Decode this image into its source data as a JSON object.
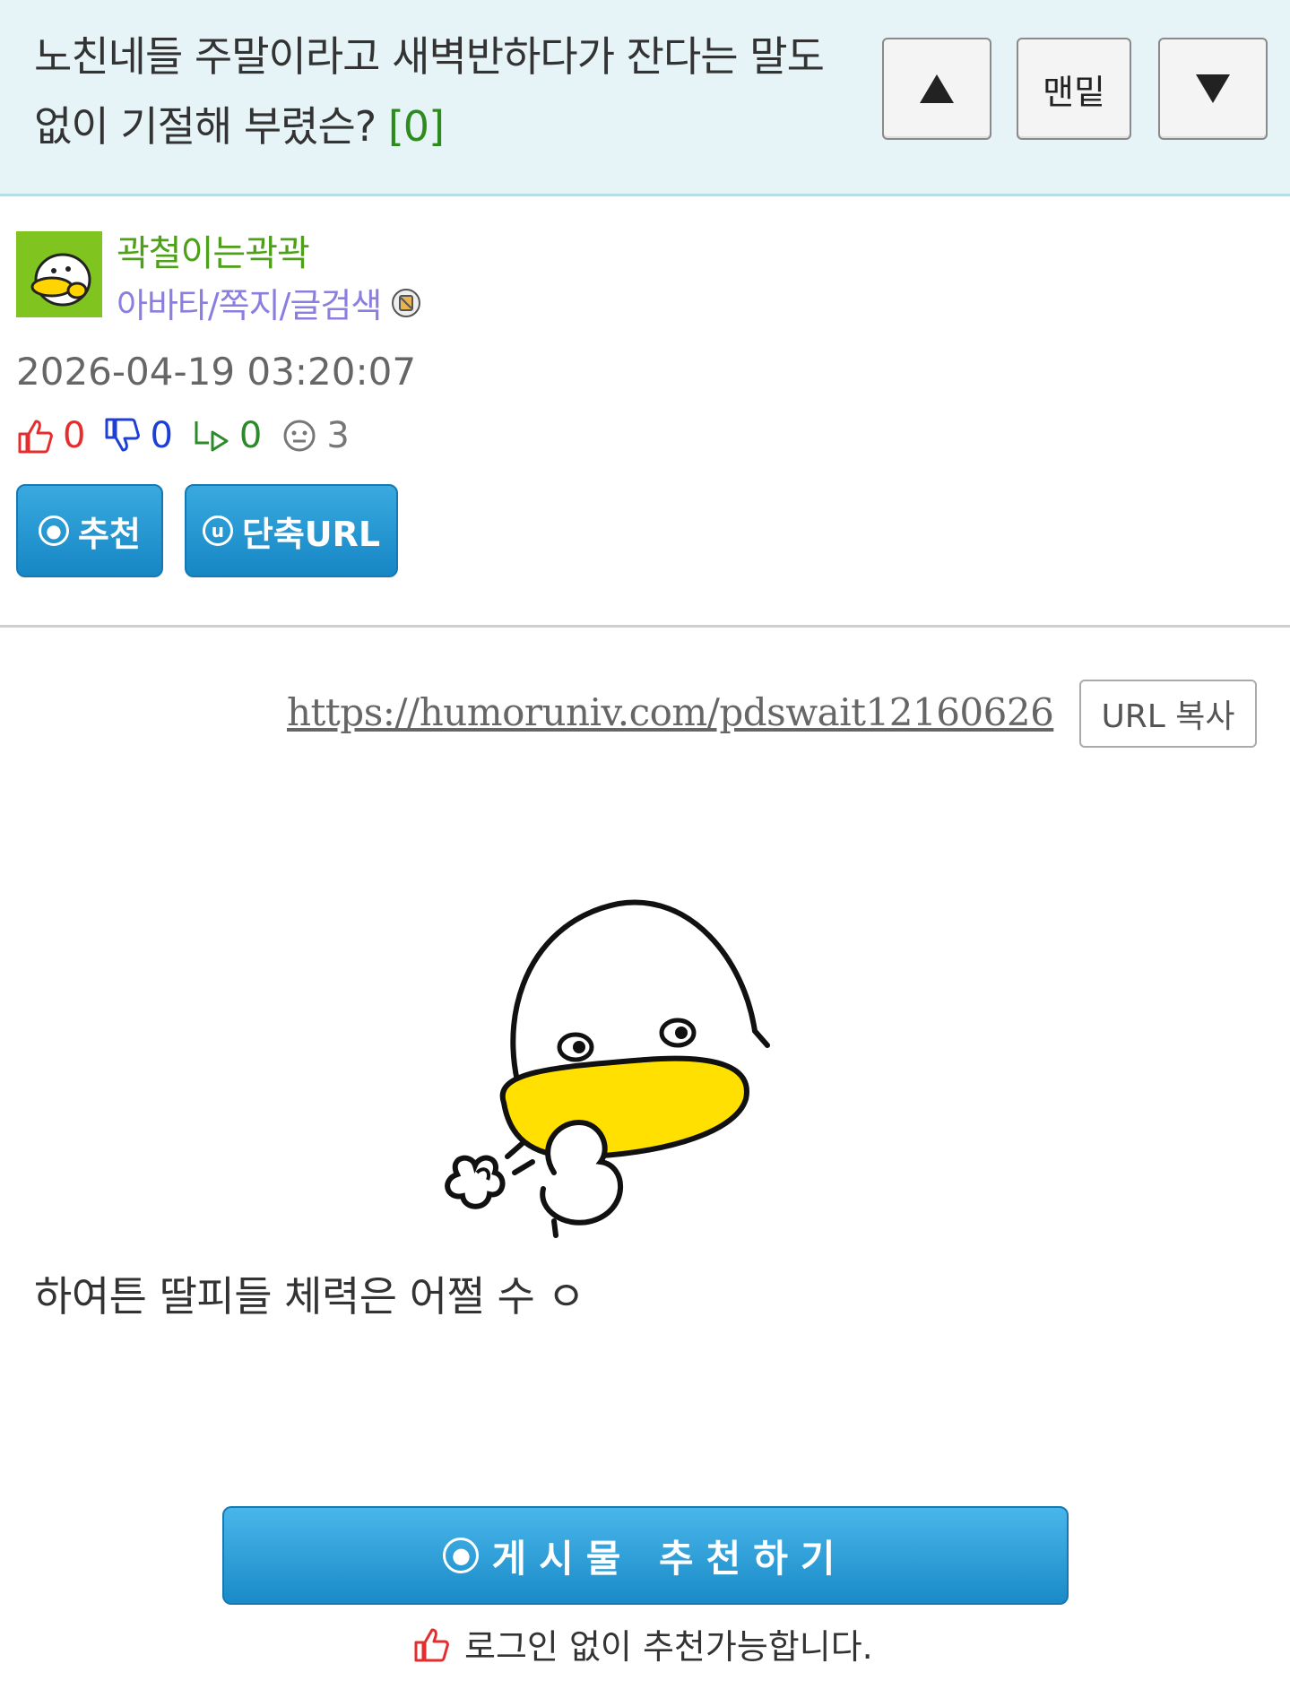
{
  "header": {
    "title": "노친네들 주말이라고 새벽반하다가 잔다는 말도 없이 기절해 부렸슨?",
    "comment_count": "[0]",
    "nav_up_icon": "up-triangle-icon",
    "nav_bottom_label": "맨밑",
    "nav_down_icon": "down-triangle-icon"
  },
  "author": {
    "name": "곽철이는곽곽",
    "links": "아바타/쪽지/글검색",
    "badge_icon": "member-badge-icon",
    "avatar_icon": "duck-avatar-icon",
    "avatar_bg": "#7fc41f"
  },
  "post": {
    "date": "2026-04-19 03:20:07",
    "stats": {
      "likes": "0",
      "dislikes": "0",
      "replies": "0",
      "views": "3"
    },
    "recommend_label": "추천",
    "short_url_label": "단축URL",
    "url": "https://humoruniv.com/pdswait12160626",
    "url_copy_label": "URL 복사",
    "image_icon": "duck-sigh-sticker",
    "body_text": "하여튼 딸피들 체력은 어쩔 수 ㅇ"
  },
  "footer": {
    "recommend_button_label": "게시물 추천하기",
    "notice": "로그인 없이 추천가능합니다."
  },
  "colors": {
    "header_bg": "#e6f4f7",
    "accent_blue": "#1a8bc8",
    "like_red": "#e52d2d",
    "dislike_blue": "#1d3fd6",
    "reply_green": "#2c8a2c",
    "author_green": "#4ea01a",
    "link_purple": "#8a7fe0"
  }
}
